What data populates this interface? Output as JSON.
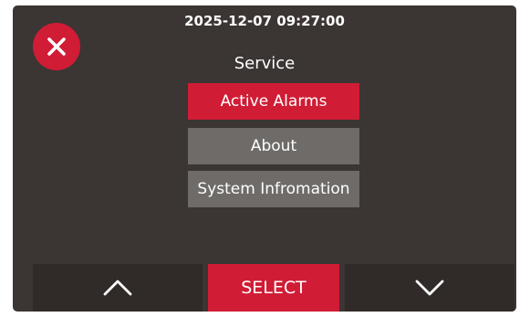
{
  "header": {
    "datetime": "2025-12-07 09:27:00",
    "title": "Service"
  },
  "close_icon": "close-x-icon",
  "menu": {
    "items": [
      {
        "label": "Active Alarms",
        "selected": true
      },
      {
        "label": "About",
        "selected": false
      },
      {
        "label": "System Infromation",
        "selected": false
      }
    ]
  },
  "nav": {
    "up_icon": "chevron-up-icon",
    "select_label": "SELECT",
    "down_icon": "chevron-down-icon"
  },
  "colors": {
    "accent": "#d01c35",
    "background": "#3b3533",
    "menu_item": "#6e6b69",
    "nav_button": "#302a28"
  }
}
